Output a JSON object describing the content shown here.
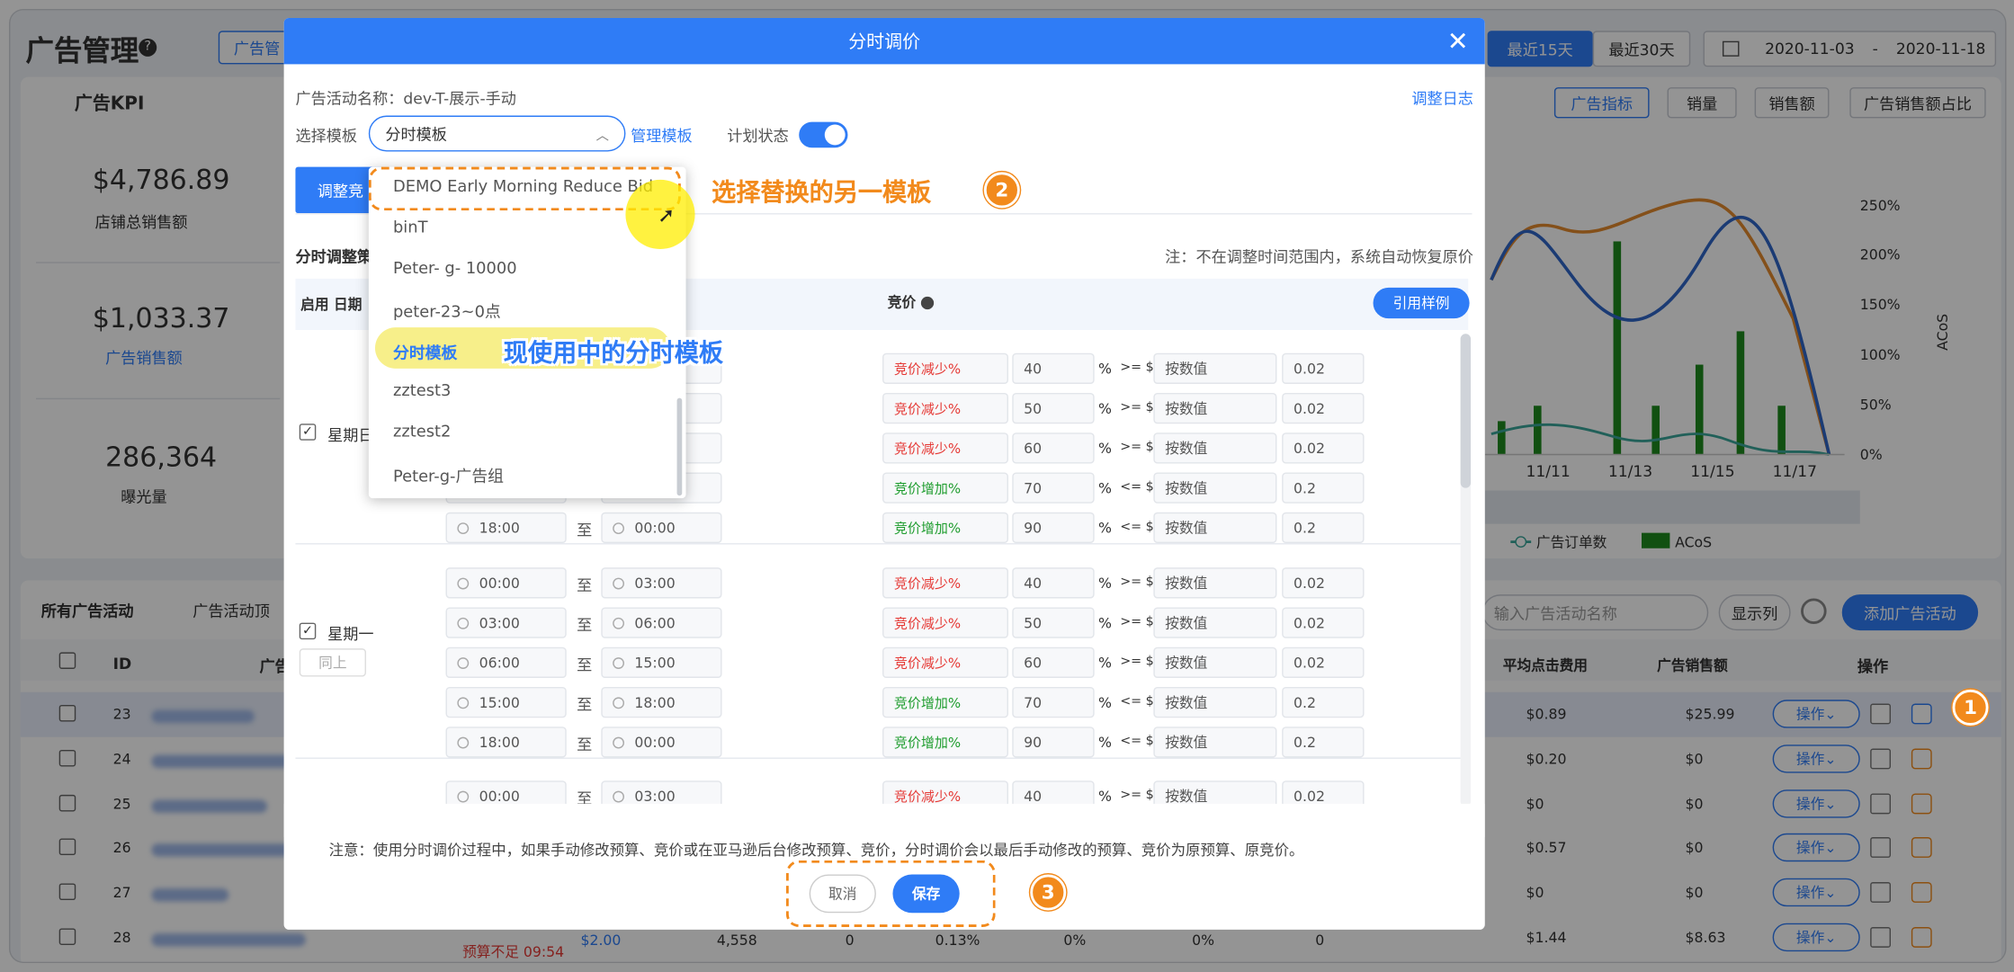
{
  "page": {
    "title": "广告管理",
    "kpi_title": "广告KPI",
    "top_tab": "广告管",
    "range_tabs": [
      "最近15天",
      "最近30天"
    ],
    "date_start": "2020-11-03",
    "date_sep": "-",
    "date_end": "2020-11-18",
    "metric_tabs": [
      "广告指标",
      "销量",
      "销售额",
      "广告销售额占比"
    ],
    "kpis": [
      {
        "value": "$4,786.89",
        "label": "店铺总销售额"
      },
      {
        "value": "$1,033.37",
        "label": "广告销售额"
      },
      {
        "value": "286,364",
        "label": "曝光量"
      }
    ],
    "chart": {
      "x_labels": [
        "11/11",
        "11/13",
        "11/15",
        "11/17"
      ],
      "y2_labels": [
        "250%",
        "200%",
        "150%",
        "100%",
        "50%",
        "0%"
      ],
      "y2_title": "ACoS",
      "legend": [
        "广告订单数",
        "ACoS"
      ]
    },
    "list": {
      "title": "所有广告活动",
      "tab2": "广告活动顶",
      "search_placeholder": "输入广告活动名称",
      "show_cols": "显示列",
      "add_btn": "添加广告活动",
      "headers": [
        "ID",
        "广告",
        "平均点击费用",
        "广告销售额",
        "操作"
      ],
      "rows": [
        {
          "id": "23",
          "cpc": "$0.89",
          "sales": "$25.99"
        },
        {
          "id": "24",
          "cpc": "$0.20",
          "sales": "$0"
        },
        {
          "id": "25",
          "cpc": "$0",
          "sales": "$0"
        },
        {
          "id": "26",
          "cpc": "$0.57",
          "sales": "$0"
        },
        {
          "id": "27",
          "cpc": "$0",
          "sales": "$0"
        },
        {
          "id": "28",
          "cpc": "$1.44",
          "sales": "$8.63"
        }
      ],
      "op_label": "操作",
      "last_row_extra": {
        "budget": "预算不足 09:54",
        "bid": "$2.00",
        "n1": "4,558",
        "n2": "0",
        "n3": "0.13%",
        "n4": "0%",
        "n5": "0%",
        "n6": "0"
      }
    }
  },
  "modal": {
    "title": "分时调价",
    "campaign_label": "广告活动名称：",
    "campaign_name": "dev-T-展示-手动",
    "log_link": "调整日志",
    "template_label": "选择模板",
    "template_value": "分时模板",
    "manage_link": "管理模板",
    "plan_label": "计划状态",
    "tab_active": "调整竞",
    "section_title": "分时调整策",
    "note": "注：不在调整时间范围内，系统自动恢复原价",
    "headers": {
      "enable_date": "启用 日期",
      "bid": "竞价",
      "sample_btn": "引用样例"
    },
    "days": [
      {
        "name": "星期日"
      },
      {
        "name": "星期一",
        "copy": "同上"
      }
    ],
    "slots": [
      {
        "from": "00:00",
        "to": "03:00",
        "type": "竞价减少%",
        "pct": "40",
        "op": ">= $",
        "mode": "按数值",
        "val": "0.02"
      },
      {
        "from": "03:00",
        "to": "06:00",
        "type": "竞价减少%",
        "pct": "50",
        "op": ">= $",
        "mode": "按数值",
        "val": "0.02"
      },
      {
        "from": "06:00",
        "to": "15:00",
        "type": "竞价减少%",
        "pct": "60",
        "op": ">= $",
        "mode": "按数值",
        "val": "0.02"
      },
      {
        "from": "15:00",
        "to": "18:00",
        "type": "竞价增加%",
        "pct": "70",
        "op": "<= $",
        "mode": "按数值",
        "val": "0.2"
      },
      {
        "from": "18:00",
        "to": "00:00",
        "type": "竞价增加%",
        "pct": "90",
        "op": "<= $",
        "mode": "按数值",
        "val": "0.2"
      }
    ],
    "to_label": "至",
    "pct_sign": "%",
    "footer_note": "注意：使用分时调价过程中，如果手动修改预算、竞价或在亚马逊后台修改预算、竞价，分时调价会以最后手动修改的预算、竞价为原预算、原竞价。",
    "cancel": "取消",
    "save": "保存",
    "dropdown": [
      "DEMO Early Morning Reduce Bid",
      "binT",
      "Peter- g- 10000",
      "peter-23~0点",
      "分时模板",
      "zztest3",
      "zztest2",
      "Peter-g-广告组"
    ]
  },
  "annotations": {
    "a2": "选择替换的另一模板",
    "a_current": "现使用中的分时模板",
    "n1": "1",
    "n2": "2",
    "n3": "3"
  },
  "colors": {
    "primary": "#2f7cf6",
    "orange": "#f28a1c",
    "decrease": "#e53935",
    "increase": "#1f9d2f"
  }
}
